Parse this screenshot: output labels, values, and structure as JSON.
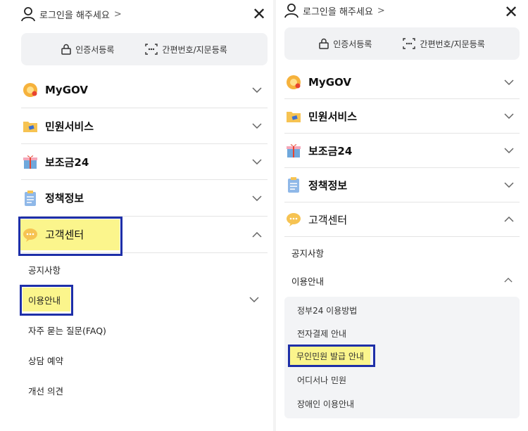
{
  "left": {
    "login_text": "로그인을 해주세요",
    "auth_cert_label": "인증서등록",
    "auth_simple_label": "간편번호/지문등록",
    "menu": [
      {
        "label": "MyGOV",
        "icon": "mygov-icon"
      },
      {
        "label": "민원서비스",
        "icon": "civil-service-icon"
      },
      {
        "label": "보조금24",
        "icon": "subsidy-icon"
      },
      {
        "label": "정책정보",
        "icon": "policy-icon"
      },
      {
        "label": "고객센터",
        "icon": "customer-center-icon"
      }
    ],
    "customer_sub": [
      "공지사항",
      "이용안내",
      "자주 묻는 질문(FAQ)",
      "상담 예약",
      "개선 의견"
    ]
  },
  "right": {
    "login_text": "로그인을 해주세요",
    "auth_cert_label": "인증서등록",
    "auth_simple_label": "간편번호/지문등록",
    "menu": [
      {
        "label": "MyGOV",
        "icon": "mygov-icon"
      },
      {
        "label": "민원서비스",
        "icon": "civil-service-icon"
      },
      {
        "label": "보조금24",
        "icon": "subsidy-icon"
      },
      {
        "label": "정책정보",
        "icon": "policy-icon"
      },
      {
        "label": "고객센터",
        "icon": "customer-center-icon"
      }
    ],
    "customer_sub": [
      "공지사항",
      "이용안내"
    ],
    "usage_sub": [
      "정부24 이용방법",
      "전자결제 안내",
      "무인민원 발급 안내",
      "어디서나 민원",
      "장애인 이용안내"
    ]
  },
  "colors": {
    "highlight": "#fbf58c",
    "box": "#1e2fa8",
    "auth_bg": "#f1f2f4"
  }
}
